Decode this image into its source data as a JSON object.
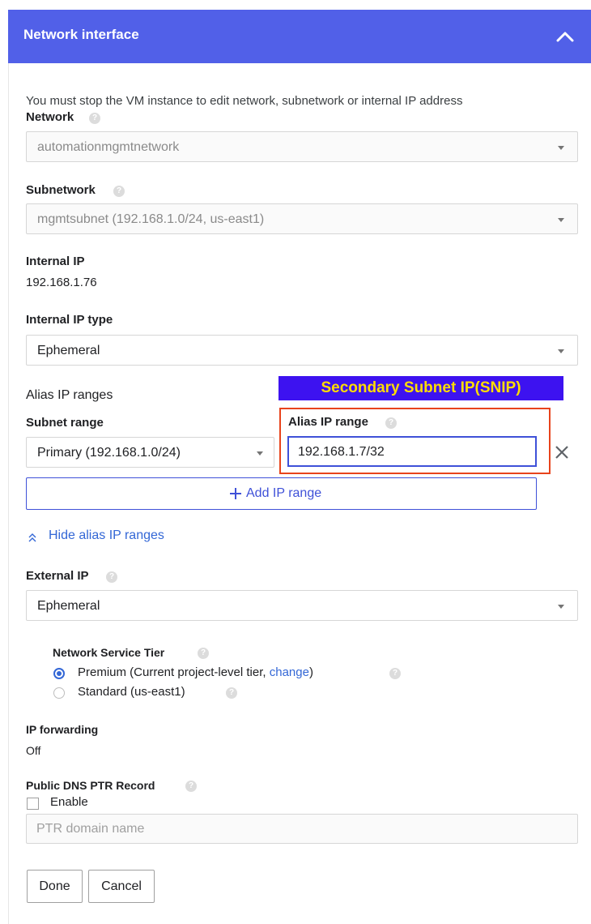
{
  "header": {
    "title": "Network interface",
    "collapse_icon": "chevron-up-icon"
  },
  "note": "You must stop the VM instance to edit network, subnetwork or internal IP address",
  "network": {
    "label": "Network",
    "value": "automationmgmtnetwork"
  },
  "subnetwork": {
    "label": "Subnetwork",
    "value": "mgmtsubnet (192.168.1.0/24, us-east1)"
  },
  "internal_ip": {
    "label": "Internal IP",
    "value": "192.168.1.76"
  },
  "internal_ip_type": {
    "label": "Internal IP type",
    "value": "Ephemeral"
  },
  "alias": {
    "section_label": "Alias IP ranges",
    "annotation": "Secondary Subnet IP(SNIP)",
    "subnet_range_label": "Subnet range",
    "subnet_range_value": "Primary (192.168.1.0/24)",
    "alias_range_label": "Alias IP range",
    "alias_range_value": "192.168.1.7/32",
    "add_label": "Add IP range",
    "hide_label": "Hide alias IP ranges"
  },
  "external_ip": {
    "label": "External IP",
    "value": "Ephemeral"
  },
  "tier": {
    "label": "Network Service Tier",
    "premium_label": "Premium (Current project-level tier, ",
    "premium_link": "change",
    "premium_close": ")",
    "standard_label": "Standard (us-east1)",
    "selected": "premium"
  },
  "ip_forwarding": {
    "label": "IP forwarding",
    "value": "Off"
  },
  "ptr": {
    "label": "Public DNS PTR Record",
    "enable_label": "Enable",
    "placeholder": "PTR domain name"
  },
  "buttons": {
    "done": "Done",
    "cancel": "Cancel"
  },
  "colors": {
    "header_bg": "#5160e8",
    "annotation_bg": "#3d12f0",
    "annotation_text": "#ffdd00",
    "highlight_border": "#e8431c",
    "focus_border": "#3f51d8",
    "link": "#3367d6"
  }
}
